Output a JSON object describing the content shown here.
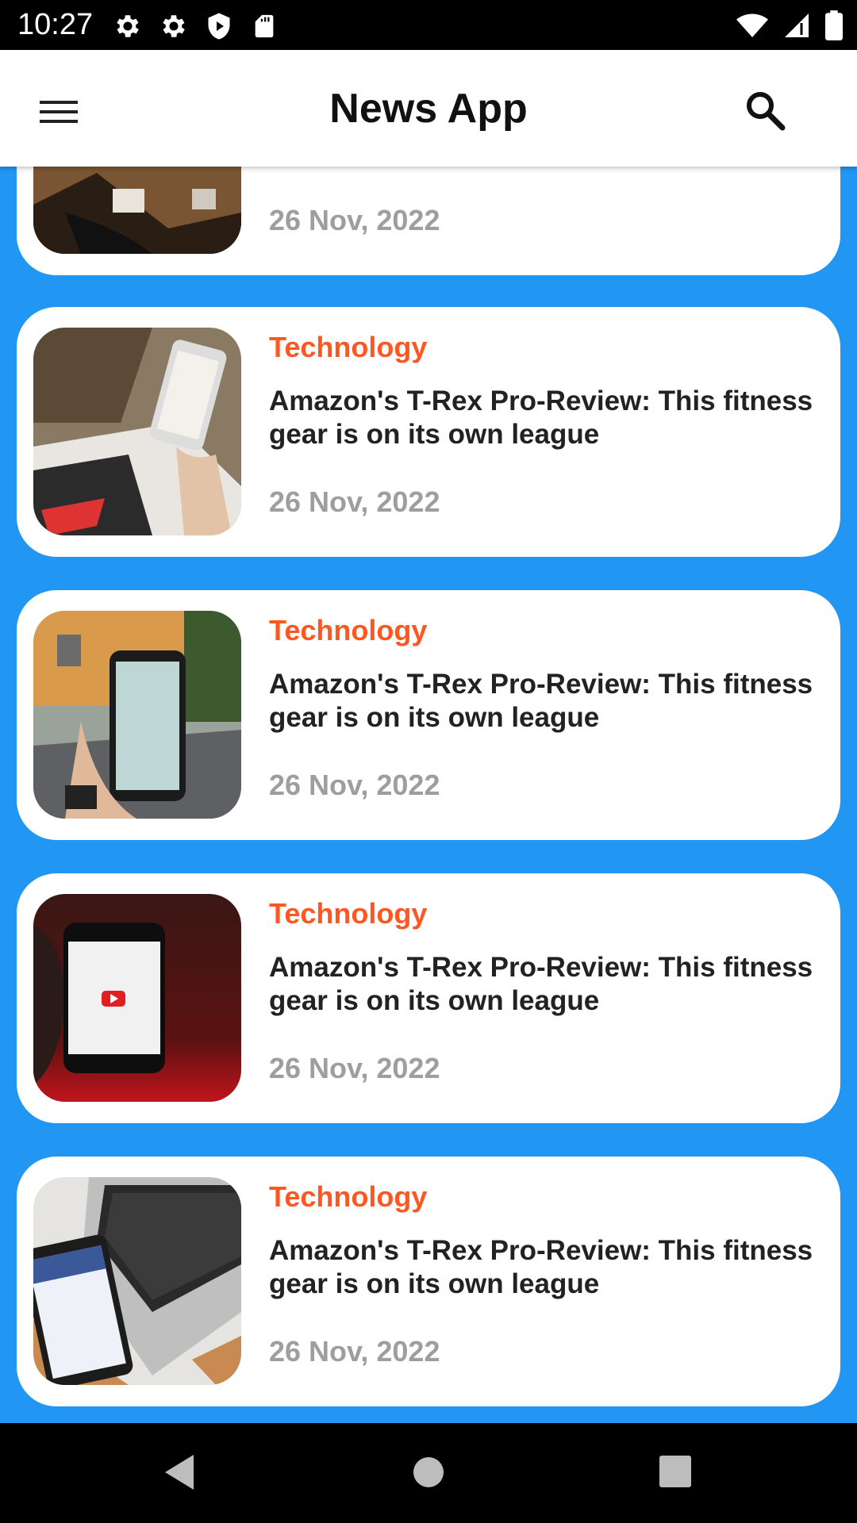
{
  "status_bar": {
    "time": "10:27",
    "left_icons": [
      "gear-icon",
      "gear-icon",
      "play-shield-icon",
      "sd-card-icon"
    ],
    "right_icons": [
      "wifi-icon",
      "cell-signal-icon",
      "battery-icon"
    ]
  },
  "app_bar": {
    "title": "News App",
    "menu_icon": "menu-icon",
    "search_icon": "search-icon"
  },
  "colors": {
    "background": "#2196F3",
    "category": "#FF5722",
    "date": "#9E9E9E"
  },
  "articles": [
    {
      "category": "",
      "title": "",
      "date": "26 Nov, 2022",
      "thumbnail": "hand-on-wooden-table"
    },
    {
      "category": "Technology",
      "title": "Amazon's T-Rex Pro-Review: This fitness gear is on its own league",
      "date": "26 Nov, 2022",
      "thumbnail": "hand-holding-phone-over-table"
    },
    {
      "category": "Technology",
      "title": "Amazon's T-Rex Pro-Review: This fitness gear is on its own league",
      "date": "26 Nov, 2022",
      "thumbnail": "phone-in-hand-on-street"
    },
    {
      "category": "Technology",
      "title": "Amazon's T-Rex Pro-Review: This fitness gear is on its own league",
      "date": "26 Nov, 2022",
      "thumbnail": "phone-with-youtube-logo-red-background"
    },
    {
      "category": "Technology",
      "title": "Amazon's T-Rex Pro-Review: This fitness gear is on its own league",
      "date": "26 Nov, 2022",
      "thumbnail": "phone-next-to-laptop"
    }
  ],
  "nav_bar": {
    "icons": [
      "back-icon",
      "home-icon",
      "recents-icon"
    ]
  }
}
